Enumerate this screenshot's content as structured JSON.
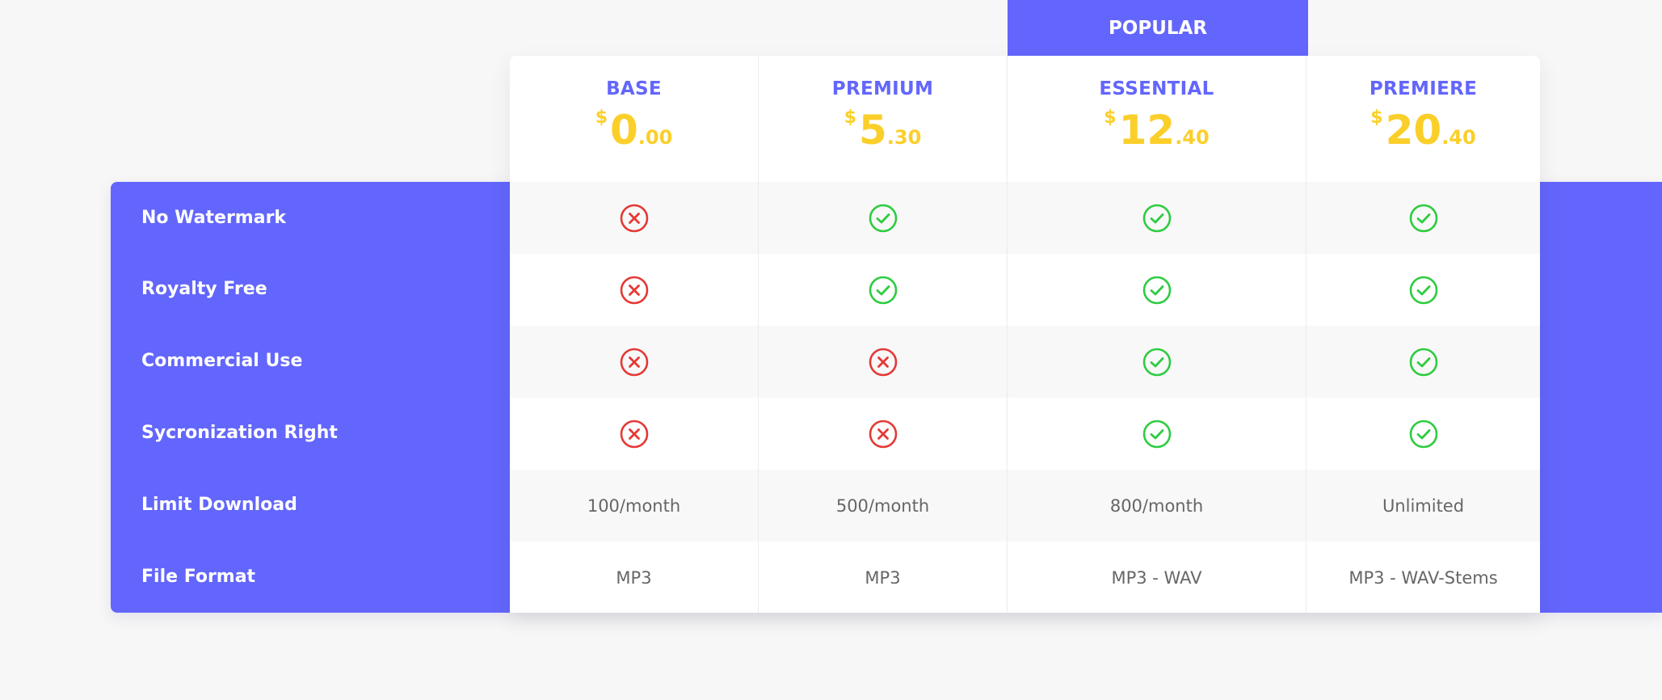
{
  "popular_label": "POPULAR",
  "features": [
    "No Watermark",
    "Royalty Free",
    "Commercial Use",
    "Sycronization Right",
    "Limit Download",
    "File Format"
  ],
  "plans": [
    {
      "name": "BASE",
      "currency": "$",
      "price_main": "0",
      "price_cents": ".00",
      "cells": [
        {
          "type": "icon",
          "icon": "x-circle-icon"
        },
        {
          "type": "icon",
          "icon": "x-circle-icon"
        },
        {
          "type": "icon",
          "icon": "x-circle-icon"
        },
        {
          "type": "icon",
          "icon": "x-circle-icon"
        },
        {
          "type": "text",
          "text": "100/month"
        },
        {
          "type": "text",
          "text": "MP3"
        }
      ]
    },
    {
      "name": "PREMIUM",
      "currency": "$",
      "price_main": "5",
      "price_cents": ".30",
      "cells": [
        {
          "type": "icon",
          "icon": "check-circle-icon"
        },
        {
          "type": "icon",
          "icon": "check-circle-icon"
        },
        {
          "type": "icon",
          "icon": "x-circle-icon"
        },
        {
          "type": "icon",
          "icon": "x-circle-icon"
        },
        {
          "type": "text",
          "text": "500/month"
        },
        {
          "type": "text",
          "text": "MP3"
        }
      ]
    },
    {
      "name": "ESSENTIAL",
      "currency": "$",
      "price_main": "12",
      "price_cents": ".40",
      "cells": [
        {
          "type": "icon",
          "icon": "check-circle-icon"
        },
        {
          "type": "icon",
          "icon": "check-circle-icon"
        },
        {
          "type": "icon",
          "icon": "check-circle-icon"
        },
        {
          "type": "icon",
          "icon": "check-circle-icon"
        },
        {
          "type": "text",
          "text": "800/month"
        },
        {
          "type": "text",
          "text": "MP3 - WAV"
        }
      ]
    },
    {
      "name": "PREMIERE",
      "currency": "$",
      "price_main": "20",
      "price_cents": ".40",
      "cells": [
        {
          "type": "icon",
          "icon": "check-circle-icon"
        },
        {
          "type": "icon",
          "icon": "check-circle-icon"
        },
        {
          "type": "icon",
          "icon": "check-circle-icon"
        },
        {
          "type": "icon",
          "icon": "check-circle-icon"
        },
        {
          "type": "text",
          "text": "Unlimited"
        },
        {
          "type": "text",
          "text": "MP3 - WAV-Stems"
        }
      ]
    }
  ],
  "colors": {
    "accent": "#6366fc",
    "price": "#fbcf2a",
    "check": "#2ecc40",
    "cross": "#e53935"
  }
}
